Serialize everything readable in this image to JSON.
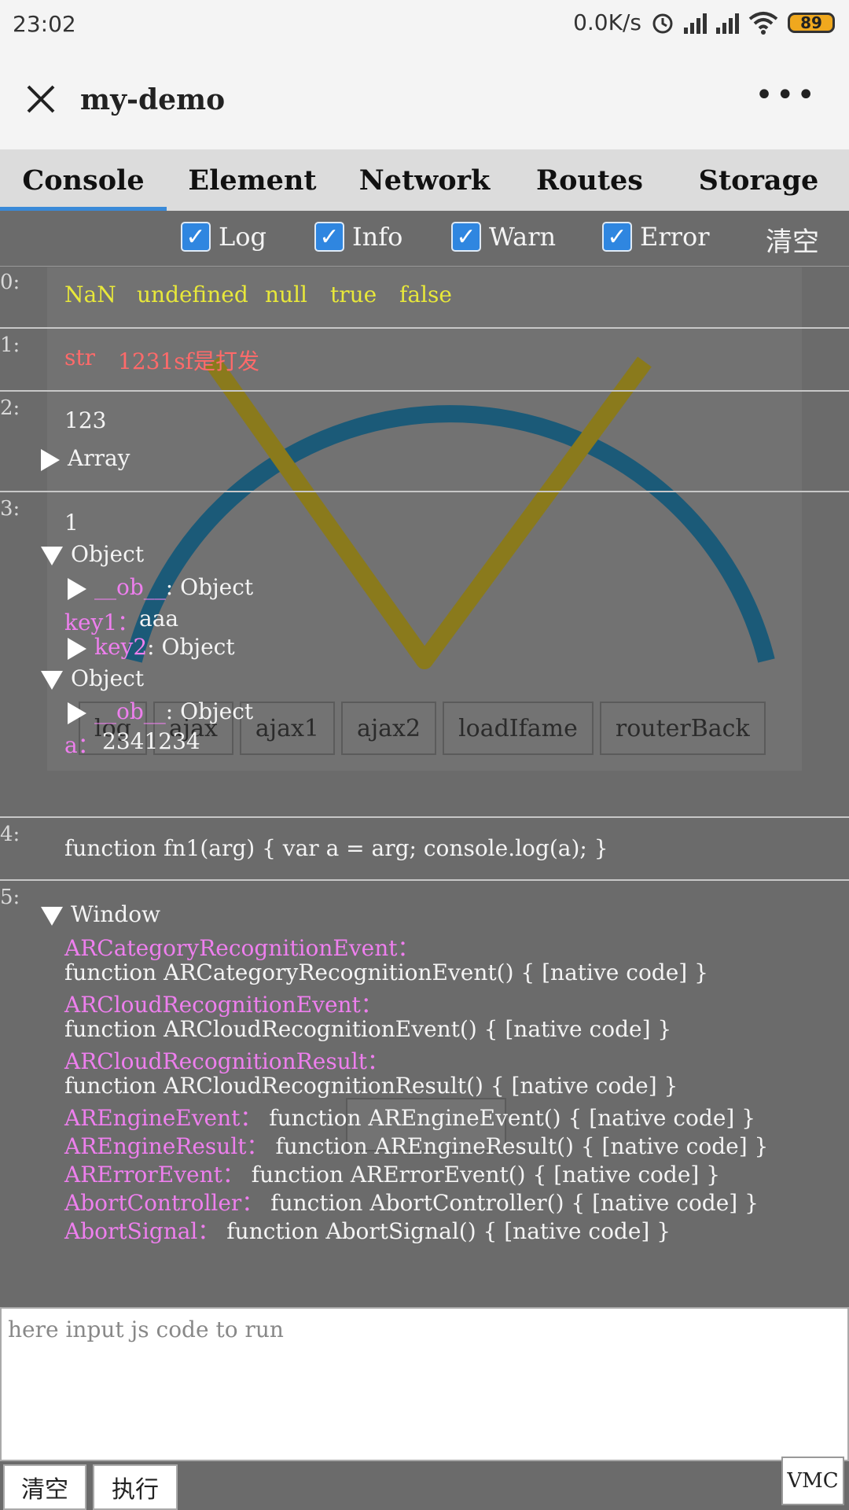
{
  "status": {
    "time": "23:02",
    "net_speed": "0.0K/s",
    "battery": "89",
    "icons": [
      "alarm-icon",
      "signal-icon",
      "signal-icon",
      "wifi-icon",
      "battery-icon"
    ]
  },
  "titlebar": {
    "title": "my-demo",
    "more": "•••"
  },
  "tabs": [
    "Console",
    "Element",
    "Network",
    "Routes",
    "Storage"
  ],
  "filters": {
    "log": "Log",
    "info": "Info",
    "warn": "Warn",
    "error": "Error",
    "clear": "清空"
  },
  "background": {
    "buttons": [
      "log",
      "ajax",
      "ajax1",
      "ajax2",
      "loadIfame",
      "routerBack"
    ],
    "result_button": "routerBack"
  },
  "console": {
    "e0": {
      "index": "0:",
      "values": [
        "NaN",
        "undefined",
        "null",
        "true",
        "false"
      ]
    },
    "e1": {
      "index": "1:",
      "str": "str",
      "value": "1231sf是打发"
    },
    "e2": {
      "index": "2:",
      "value": "123",
      "array": "Array"
    },
    "e3": {
      "index": "3:",
      "value": "1",
      "object1": "Object",
      "ob1_key": "__ob__",
      "ob1_val": ": Object",
      "key1": "key1：",
      "key1_val": "aaa",
      "key2": "key2",
      "key2_val": ": Object",
      "object2": "Object",
      "ob2_key": "__ob__",
      "ob2_val": ": Object",
      "a_key": "a：",
      "a_val": "2341234"
    },
    "e4": {
      "index": "4:",
      "value": "function fn1(arg) { var a = arg; console.log(a); }"
    },
    "e5": {
      "index": "5:",
      "window": "Window",
      "k1": "ARCategoryRecognitionEvent：",
      "v1": "function ARCategoryRecognitionEvent() { [native code] }",
      "k2": "ARCloudRecognitionEvent：",
      "v2": "function ARCloudRecognitionEvent() { [native code] }",
      "k3": "ARCloudRecognitionResult：",
      "v3": "function ARCloudRecognitionResult() { [native code] }",
      "k4": "AREngineEvent：",
      "v4": "function AREngineEvent() { [native code] }",
      "k5": "AREngineResult：",
      "v5": "function AREngineResult() { [native code] }",
      "k6": "ARErrorEvent：",
      "v6": "function ARErrorEvent() { [native code] }",
      "k7": "AbortController：",
      "v7": "function AbortController() { [native code] }",
      "k8": "AbortSignal：",
      "v8": "function AbortSignal() { [native code] }"
    }
  },
  "input": {
    "placeholder": "here input js code to run"
  },
  "bottom": {
    "clear": "清空",
    "run": "执行",
    "vmc": "VMC"
  },
  "colors": {
    "accent": "#3a8ad8",
    "checkbox": "#2f86e0",
    "key": "#ee7fee",
    "primitive": "#e8e83a",
    "string": "#ff6a6a"
  }
}
